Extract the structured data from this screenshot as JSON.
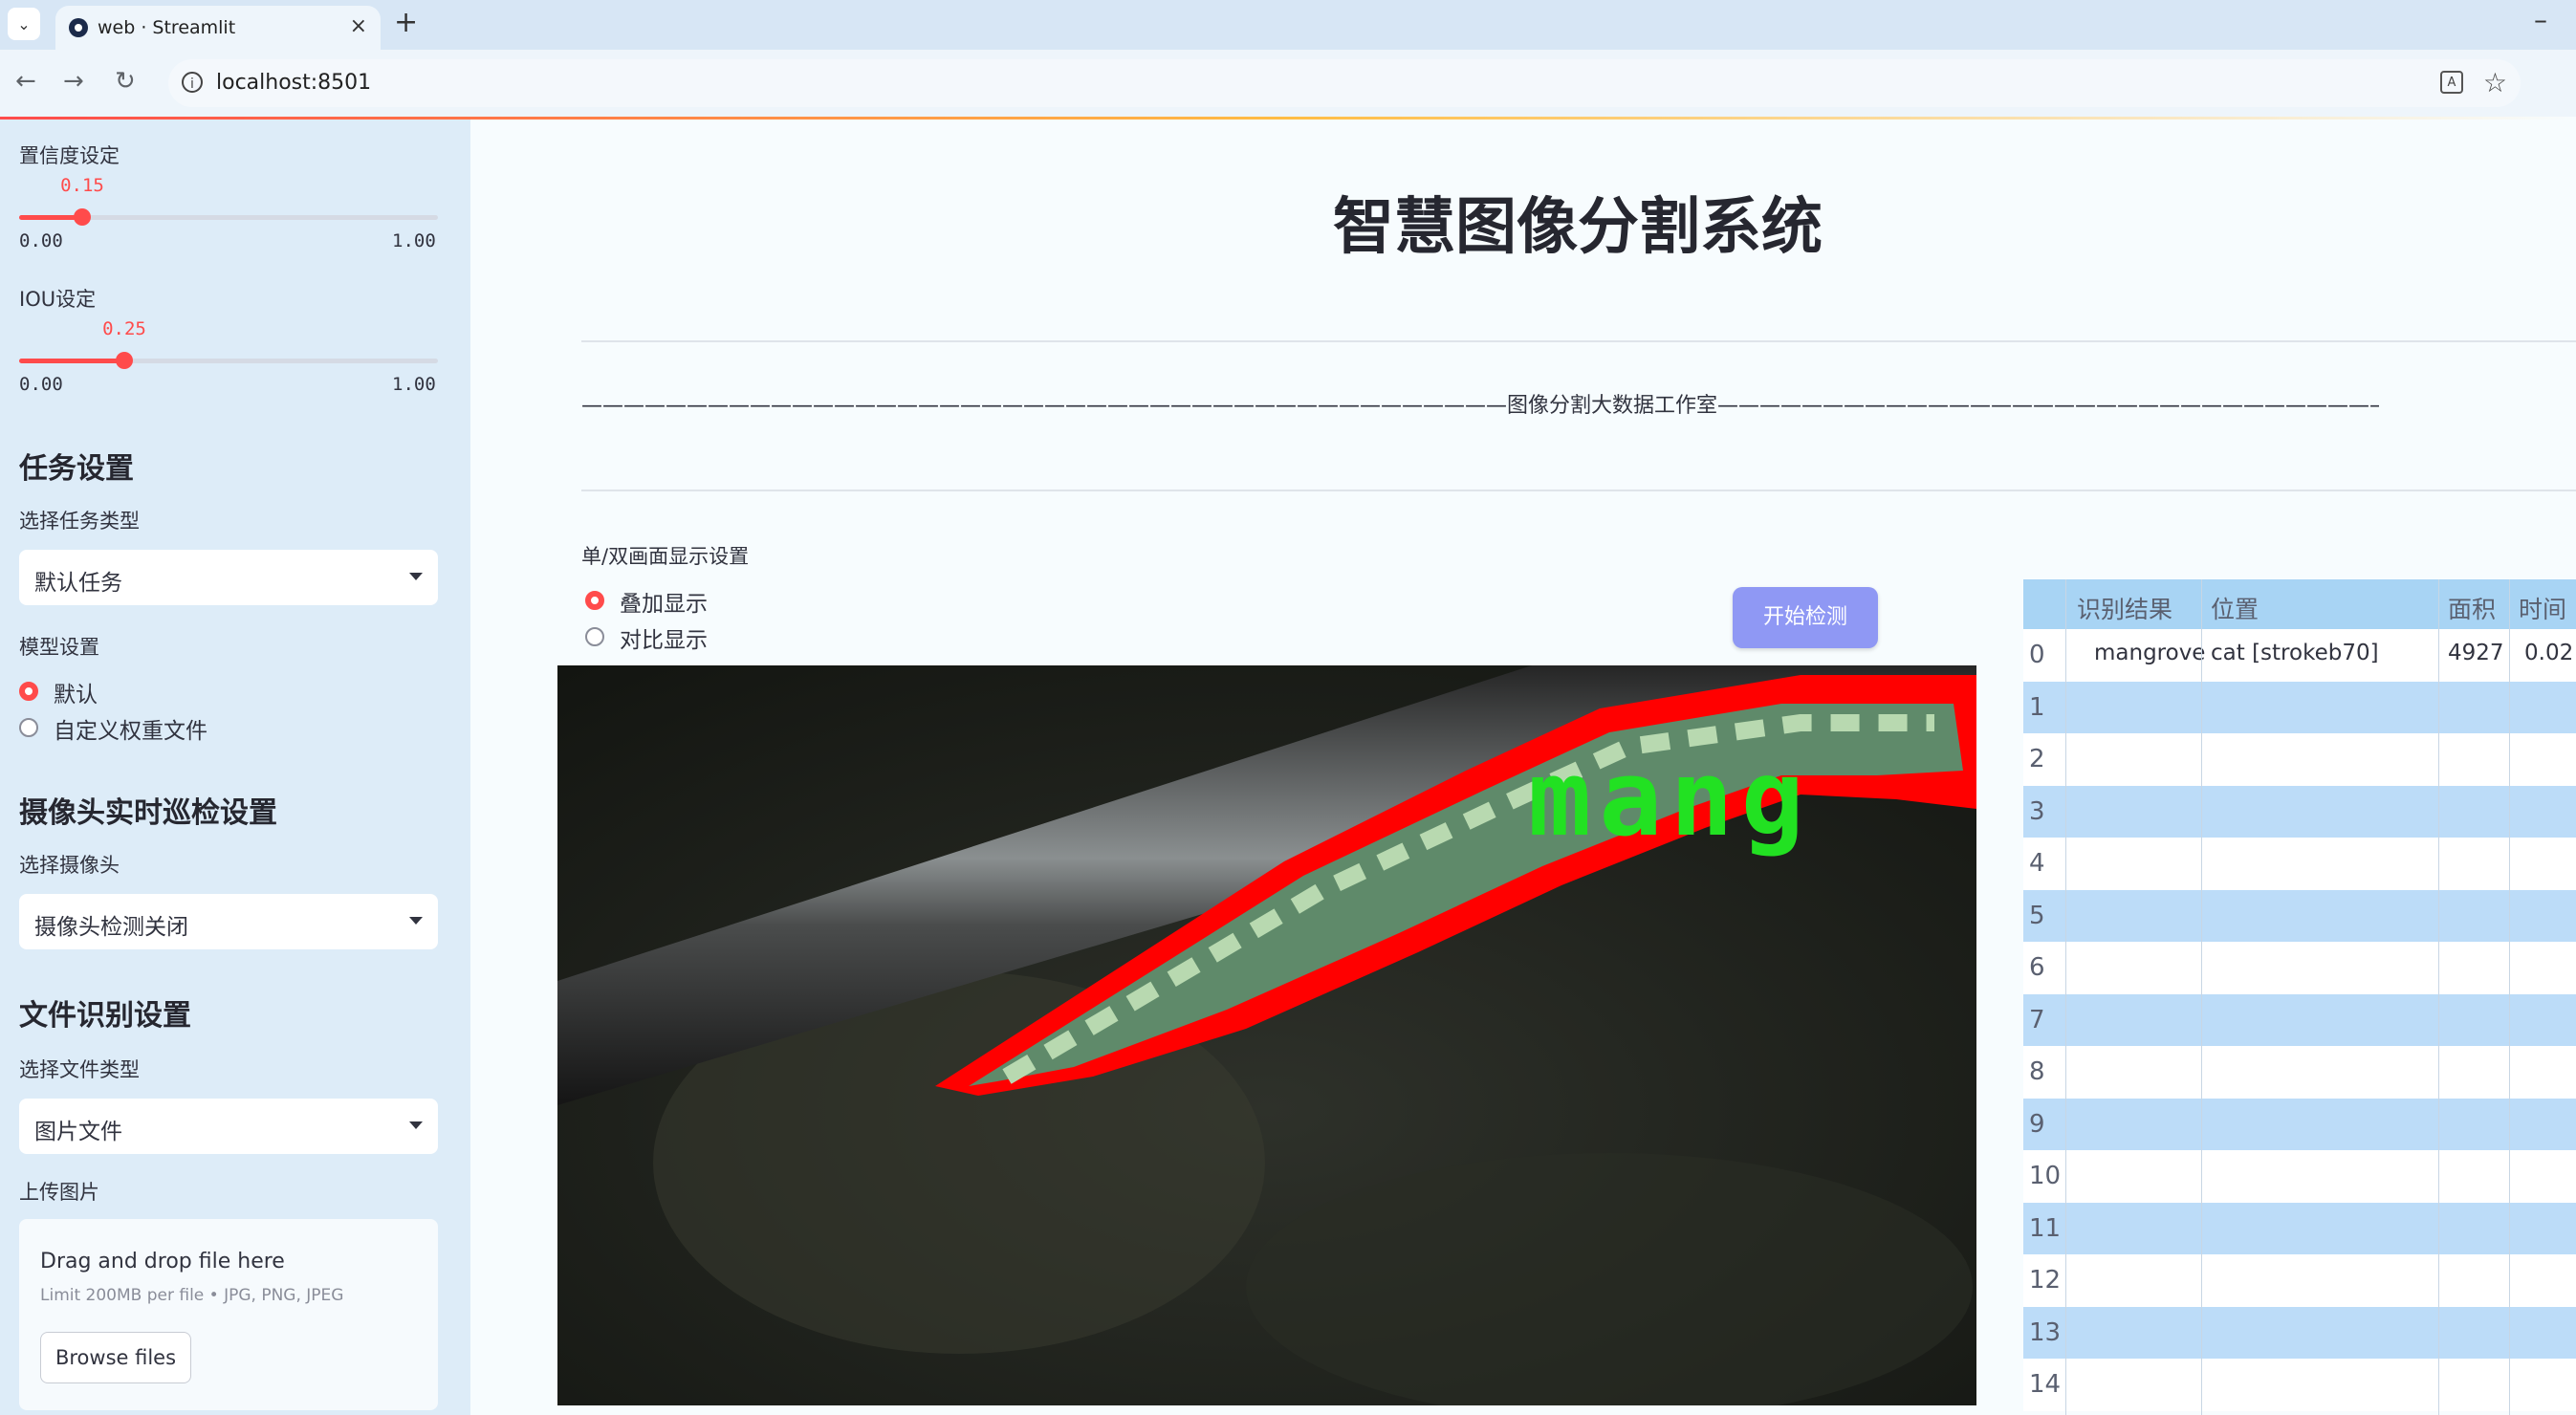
{
  "browser": {
    "tab_title": "web · Streamlit",
    "url": "localhost:8501"
  },
  "sidebar": {
    "confidence": {
      "label": "置信度设定",
      "value": "0.15",
      "level": 0.15,
      "min": "0.00",
      "max": "1.00"
    },
    "iou": {
      "label": "IOU设定",
      "value": "0.25",
      "level": 0.25,
      "min": "0.00",
      "max": "1.00"
    },
    "task_heading": "任务设置",
    "task_type_label": "选择任务类型",
    "task_type_value": "默认任务",
    "model_label": "模型设置",
    "model_options": [
      "默认",
      "自定义权重文件"
    ],
    "model_selected": "默认",
    "camera_heading": "摄像头实时巡检设置",
    "camera_label": "选择摄像头",
    "camera_value": "摄像头检测关闭",
    "file_heading": "文件识别设置",
    "file_type_label": "选择文件类型",
    "file_type_value": "图片文件",
    "upload_label": "上传图片",
    "upload_main": "Drag and drop file here",
    "upload_sub": "Limit 200MB per file • JPG, PNG, JPEG",
    "browse_label": "Browse files"
  },
  "main": {
    "title": "智慧图像分割系统",
    "studio_line": "————————————————————————————————————————————图像分割大数据工作室————————————————————————————————————————————",
    "display_label": "单/双画面显示设置",
    "display_options": [
      "叠加显示",
      "对比显示"
    ],
    "display_selected": "叠加显示",
    "detect_button": "开始检测",
    "detection_label": "mang"
  },
  "table": {
    "headers": [
      "识别结果",
      "位置",
      "面积",
      "时间"
    ],
    "rows": [
      {
        "index": "0",
        "result": "mangrove",
        "position": "cat [strokeb70]",
        "area": "4927",
        "time": "0.02"
      },
      {
        "index": "1"
      },
      {
        "index": "2"
      },
      {
        "index": "3"
      },
      {
        "index": "4"
      },
      {
        "index": "5"
      },
      {
        "index": "6"
      },
      {
        "index": "7"
      },
      {
        "index": "8"
      },
      {
        "index": "9"
      },
      {
        "index": "10"
      },
      {
        "index": "11"
      },
      {
        "index": "12"
      },
      {
        "index": "13"
      },
      {
        "index": "14"
      }
    ]
  },
  "colors": {
    "accent": "#ff4b4b",
    "sidebar_bg": "#ddecf8",
    "button_bg": "#8f98f4",
    "mask_outline": "#ff0000",
    "label_green": "#22e122"
  }
}
